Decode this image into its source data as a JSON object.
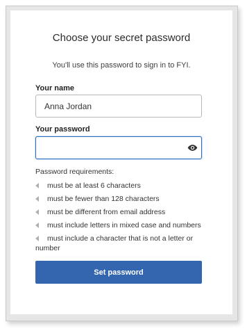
{
  "form": {
    "title": "Choose your secret password",
    "subtitle": "You'll use this password to sign in to FYI.",
    "name_label": "Your name",
    "name_value": "Anna Jordan",
    "password_label": "Your password",
    "password_value": "",
    "show_password_icon": "eye-icon",
    "requirements_title": "Password requirements:",
    "requirements": [
      "must be at least 6 characters",
      "must be fewer than 128 characters",
      "must be different from email address",
      "must include letters in mixed case and numbers",
      "must include a character that is not a letter or number"
    ],
    "submit_label": "Set password"
  },
  "colors": {
    "button_bg": "#3466b0",
    "focus_border": "#2d6dbf"
  }
}
